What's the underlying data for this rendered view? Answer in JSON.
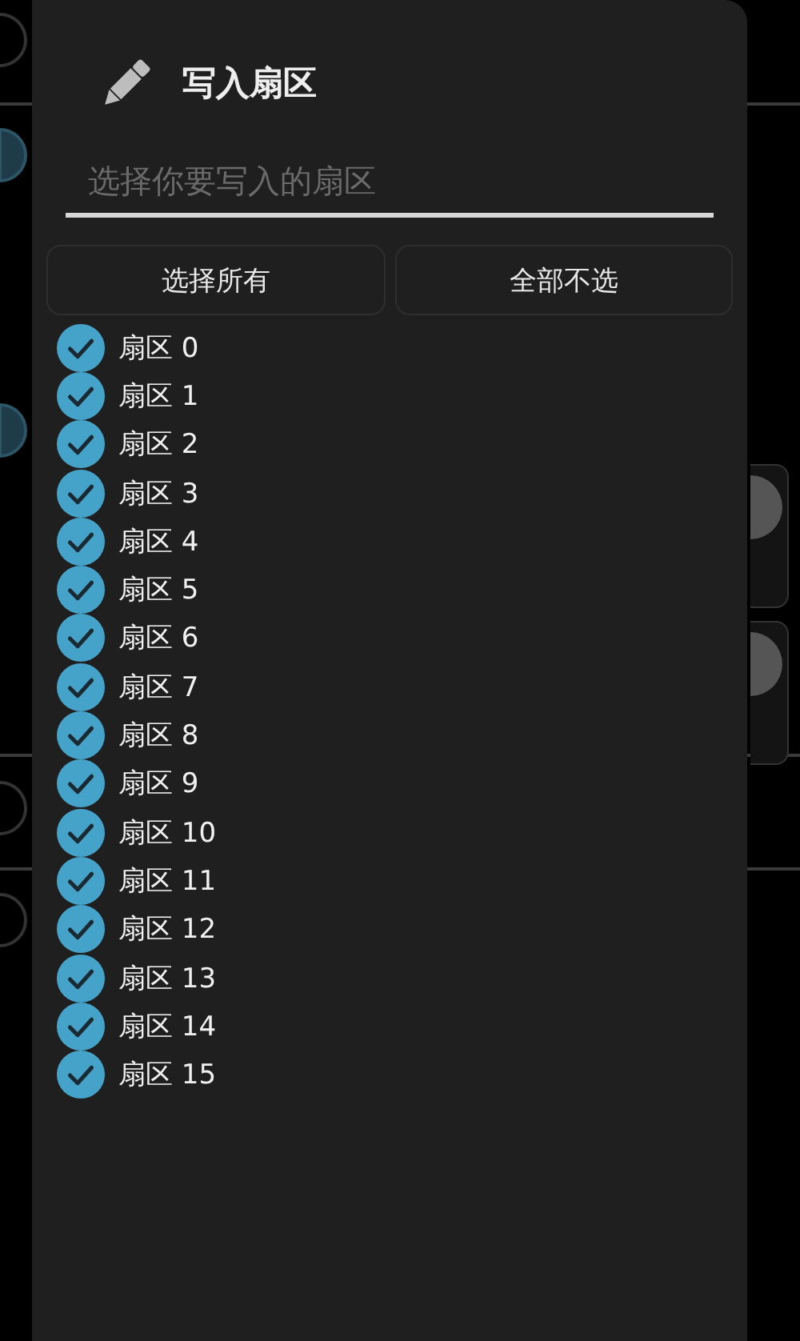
{
  "background": {
    "radios": [
      {
        "selected": false
      },
      {
        "selected": true
      },
      {
        "selected": true
      },
      {
        "selected": false
      },
      {
        "selected": false
      }
    ],
    "switches": [
      {
        "on": false
      },
      {
        "on": false
      }
    ]
  },
  "dialog": {
    "title": "写入扇区",
    "field": {
      "placeholder": "选择你要写入的扇区"
    },
    "buttons": [
      "选择所有",
      "全部不选"
    ],
    "sectors": [
      {
        "label": "扇区 0",
        "checked": true
      },
      {
        "label": "扇区 1",
        "checked": true
      },
      {
        "label": "扇区 2",
        "checked": true
      },
      {
        "label": "扇区 3",
        "checked": true
      },
      {
        "label": "扇区 4",
        "checked": true
      },
      {
        "label": "扇区 5",
        "checked": true
      },
      {
        "label": "扇区 6",
        "checked": true
      },
      {
        "label": "扇区 7",
        "checked": true
      },
      {
        "label": "扇区 8",
        "checked": true
      },
      {
        "label": "扇区 9",
        "checked": true
      },
      {
        "label": "扇区 10",
        "checked": true
      },
      {
        "label": "扇区 11",
        "checked": true
      },
      {
        "label": "扇区 12",
        "checked": true
      },
      {
        "label": "扇区 13",
        "checked": true
      },
      {
        "label": "扇区 14",
        "checked": true
      },
      {
        "label": "扇区 15",
        "checked": true
      }
    ]
  }
}
